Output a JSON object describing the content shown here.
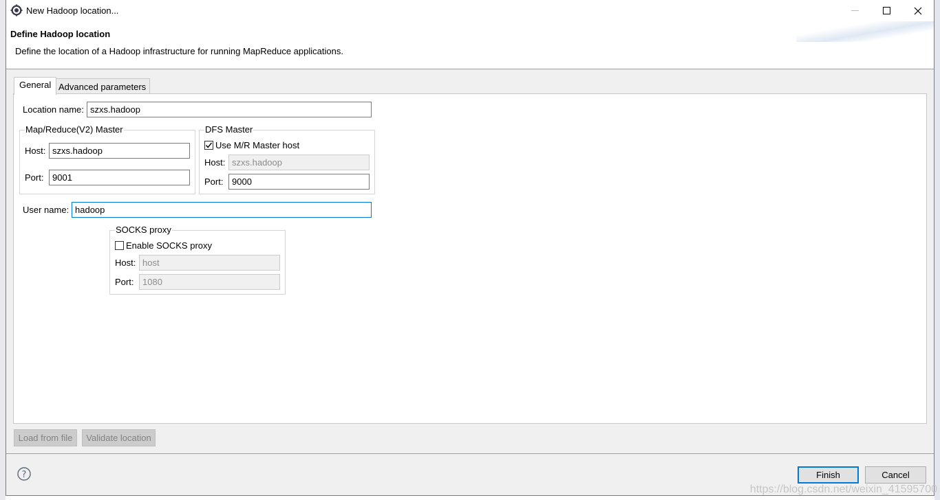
{
  "window": {
    "title": "New Hadoop location...",
    "app_icon": "gear-icon",
    "controls": [
      "minimize-icon",
      "maximize-icon",
      "close-icon"
    ]
  },
  "banner": {
    "title": "Define Hadoop location",
    "description": "Define the location of a Hadoop infrastructure for running MapReduce applications."
  },
  "tabs": [
    {
      "label": "General",
      "selected": true
    },
    {
      "label": "Advanced parameters",
      "selected": false
    }
  ],
  "general": {
    "location_name_label": "Location name:",
    "location_name_value": "szxs.hadoop",
    "mr_master": {
      "title": "Map/Reduce(V2) Master",
      "host_label": "Host:",
      "host_value": "szxs.hadoop",
      "port_label": "Port:",
      "port_value": "9001"
    },
    "dfs_master": {
      "title": "DFS Master",
      "use_mr_host_label": "Use M/R Master host",
      "use_mr_host_checked": true,
      "host_label": "Host:",
      "host_value": "szxs.hadoop",
      "port_label": "Port:",
      "port_value": "9000"
    },
    "user_name_label": "User name:",
    "user_name_value": "hadoop",
    "socks": {
      "title": "SOCKS proxy",
      "enable_label": "Enable SOCKS proxy",
      "enable_checked": false,
      "host_label": "Host:",
      "host_value": "host",
      "port_label": "Port:",
      "port_value": "1080"
    }
  },
  "actions": {
    "load_label": "Load from file",
    "validate_label": "Validate location"
  },
  "footer": {
    "help_icon": "help-icon",
    "finish_label": "Finish",
    "cancel_label": "Cancel"
  },
  "watermark": "https://blog.csdn.net/weixin_41595700",
  "colors": {
    "focus_border": "#0078d7",
    "disabled_field": "#f0f0f0",
    "dialog_bg": "#f0f0f0"
  }
}
